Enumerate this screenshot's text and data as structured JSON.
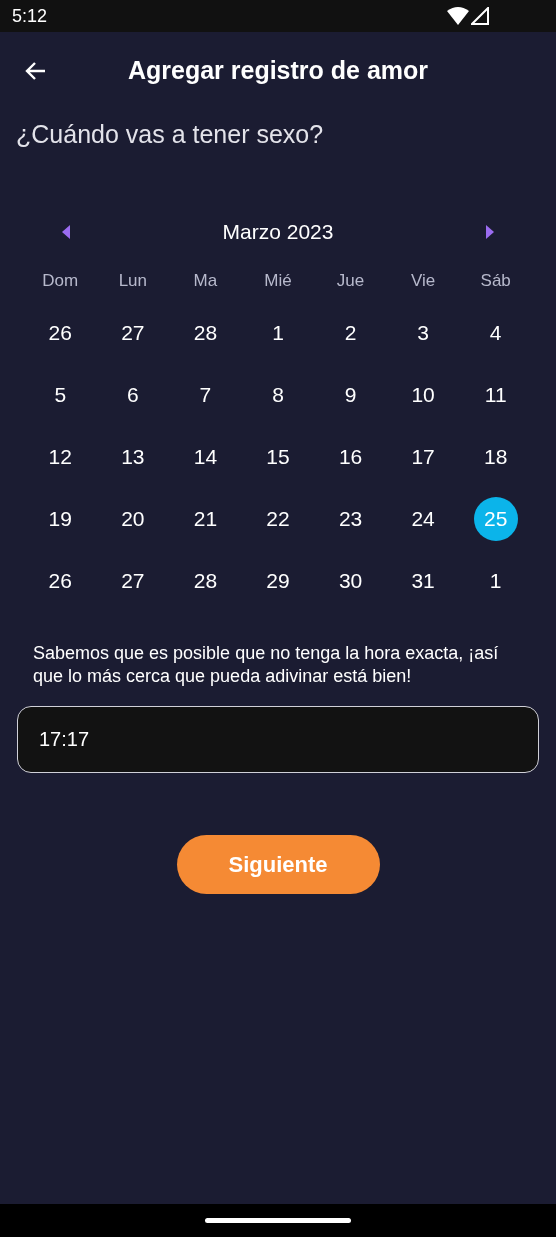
{
  "status_bar": {
    "time": "5:12"
  },
  "header": {
    "title": "Agregar registro de amor"
  },
  "question": "¿Cuándo vas a tener sexo?",
  "calendar": {
    "month": "Marzo 2023",
    "weekdays": [
      "Dom",
      "Lun",
      "Ma",
      "Mié",
      "Jue",
      "Vie",
      "Sáb"
    ],
    "weeks": [
      [
        {
          "day": "26",
          "selected": false
        },
        {
          "day": "27",
          "selected": false
        },
        {
          "day": "28",
          "selected": false
        },
        {
          "day": "1",
          "selected": false
        },
        {
          "day": "2",
          "selected": false
        },
        {
          "day": "3",
          "selected": false
        },
        {
          "day": "4",
          "selected": false
        }
      ],
      [
        {
          "day": "5",
          "selected": false
        },
        {
          "day": "6",
          "selected": false
        },
        {
          "day": "7",
          "selected": false
        },
        {
          "day": "8",
          "selected": false
        },
        {
          "day": "9",
          "selected": false
        },
        {
          "day": "10",
          "selected": false
        },
        {
          "day": "11",
          "selected": false
        }
      ],
      [
        {
          "day": "12",
          "selected": false
        },
        {
          "day": "13",
          "selected": false
        },
        {
          "day": "14",
          "selected": false
        },
        {
          "day": "15",
          "selected": false
        },
        {
          "day": "16",
          "selected": false
        },
        {
          "day": "17",
          "selected": false
        },
        {
          "day": "18",
          "selected": false
        }
      ],
      [
        {
          "day": "19",
          "selected": false
        },
        {
          "day": "20",
          "selected": false
        },
        {
          "day": "21",
          "selected": false
        },
        {
          "day": "22",
          "selected": false
        },
        {
          "day": "23",
          "selected": false
        },
        {
          "day": "24",
          "selected": false
        },
        {
          "day": "25",
          "selected": true
        }
      ],
      [
        {
          "day": "26",
          "selected": false
        },
        {
          "day": "27",
          "selected": false
        },
        {
          "day": "28",
          "selected": false
        },
        {
          "day": "29",
          "selected": false
        },
        {
          "day": "30",
          "selected": false
        },
        {
          "day": "31",
          "selected": false
        },
        {
          "day": "1",
          "selected": false
        }
      ]
    ]
  },
  "hint": "Sabemos que es posible que no tenga la hora exacta, ¡así que lo más cerca que pueda adivinar está bien!",
  "time_field": {
    "value": "17:17"
  },
  "next_button": "Siguiente"
}
